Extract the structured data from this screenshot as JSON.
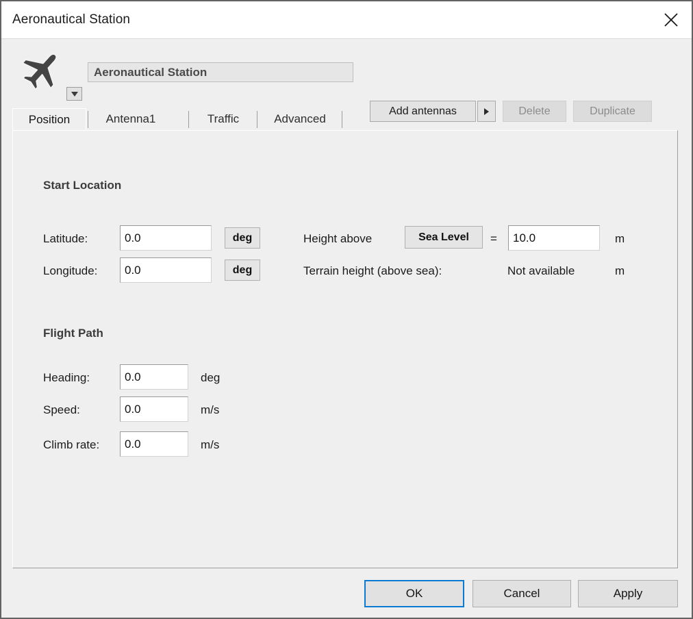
{
  "window": {
    "title": "Aeronautical Station",
    "close_icon": "close-icon"
  },
  "header": {
    "station_icon": "airplane-icon",
    "icon_dropdown_caret": "chevron-down-icon",
    "name_value": "Aeronautical Station",
    "add_antennas_label": "Add antennas",
    "add_antennas_arrow_icon": "chevron-right-icon",
    "delete_label": "Delete",
    "delete_enabled": false,
    "duplicate_label": "Duplicate",
    "duplicate_enabled": false
  },
  "tabs": [
    {
      "label": "Position",
      "active": true
    },
    {
      "label": "Antenna1",
      "active": false
    },
    {
      "label": "Traffic",
      "active": false
    },
    {
      "label": "Advanced",
      "active": false
    }
  ],
  "position_tab": {
    "start_location": {
      "heading": "Start Location",
      "latitude_label": "Latitude:",
      "latitude_value": "0.0",
      "latitude_unit": "deg",
      "longitude_label": "Longitude:",
      "longitude_value": "0.0",
      "longitude_unit": "deg",
      "height_above_label": "Height above",
      "height_reference": "Sea Level",
      "equals_sign": "=",
      "height_value": "10.0",
      "height_unit": "m",
      "terrain_height_label": "Terrain height (above sea):",
      "terrain_height_value": "Not available",
      "terrain_height_unit": "m"
    },
    "flight_path": {
      "heading": "Flight Path",
      "heading_label": "Heading:",
      "heading_value": "0.0",
      "heading_unit": "deg",
      "speed_label": "Speed:",
      "speed_value": "0.0",
      "speed_unit": "m/s",
      "climb_rate_label": "Climb rate:",
      "climb_rate_value": "0.0",
      "climb_rate_unit": "m/s"
    }
  },
  "footer": {
    "ok_label": "OK",
    "cancel_label": "Cancel",
    "apply_label": "Apply"
  },
  "colors": {
    "accent": "#0a7bd4",
    "window_bg": "#efefef",
    "titlebar_bg": "#ffffff",
    "border": "#636363"
  }
}
